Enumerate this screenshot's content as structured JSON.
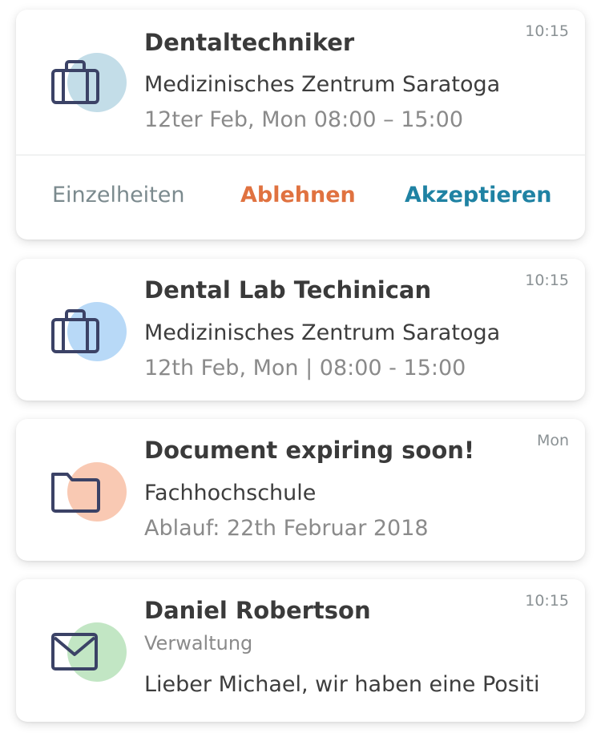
{
  "notifications": [
    {
      "time": "10:15",
      "icon": "briefcase-icon",
      "icon_bg": "#c3dde8",
      "title": "Dentaltechniker",
      "line1": "Medizinisches Zentrum Saratoga",
      "line2": "12ter Feb, Mon 08:00 – 15:00",
      "actions": {
        "details": "Einzelheiten",
        "reject": "Ablehnen",
        "accept": "Akzeptieren"
      }
    },
    {
      "time": "10:15",
      "icon": "briefcase-icon",
      "icon_bg": "#b8d9f7",
      "title": "Dental Lab Techinican",
      "line1": "Medizinisches Zentrum Saratoga",
      "line2": "12th Feb, Mon | 08:00 - 15:00"
    },
    {
      "time": "Mon",
      "icon": "folder-icon",
      "icon_bg": "#f9c9b3",
      "title": "Document expiring soon!",
      "line1": "Fachhochschule",
      "line2": "Ablauf: 22th Februar 2018"
    },
    {
      "time": "10:15",
      "icon": "envelope-icon",
      "icon_bg": "#c2e6c4",
      "title": "Daniel Robertson",
      "line1": "Verwaltung",
      "line2": "Lieber Michael, wir haben eine Positi"
    }
  ],
  "colors": {
    "icon_stroke": "#3b4266",
    "reject": "#e07240",
    "accept": "#1f82a3"
  }
}
